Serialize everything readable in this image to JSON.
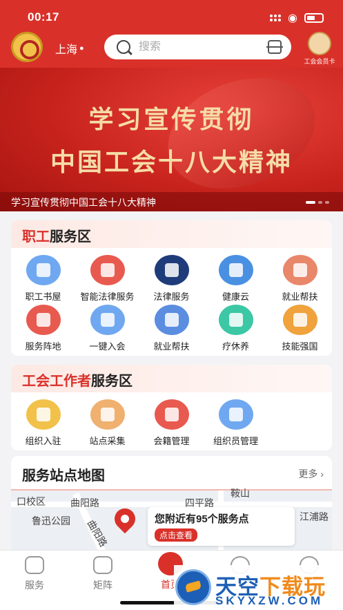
{
  "status_bar": {
    "time": "00:17"
  },
  "header": {
    "city": "上海",
    "search_placeholder": "搜索",
    "member_card_label": "工会会员卡"
  },
  "banner": {
    "line1": "学习宣传贯彻",
    "line2": "中国工会十八大精神",
    "caption": "学习宣传贯彻中国工会十八大精神",
    "slides": 3,
    "active_slide": 1
  },
  "employee_zone": {
    "title_red": "职工",
    "title_black": "服务区",
    "items": [
      {
        "label": "职工书屋",
        "icon": "book-icon",
        "color": "#6fa8f0"
      },
      {
        "label": "智能法律服务",
        "icon": "ai-law-icon",
        "color": "#e85a4f"
      },
      {
        "label": "法律服务",
        "icon": "12351-icon",
        "color": "#1f3c7a"
      },
      {
        "label": "健康云",
        "icon": "cloud-plus-icon",
        "color": "#4a90e2"
      },
      {
        "label": "就业帮扶",
        "icon": "resume-icon",
        "color": "#e9876a"
      },
      {
        "label": "服务阵地",
        "icon": "map-pin-icon",
        "color": "#e85a4f"
      },
      {
        "label": "一键入会",
        "icon": "user-join-icon",
        "color": "#6fa8f0"
      },
      {
        "label": "就业帮扶",
        "icon": "job-badge-icon",
        "color": "#5b8de0"
      },
      {
        "label": "疗休养",
        "icon": "palm-tree-icon",
        "color": "#3cc7a5"
      },
      {
        "label": "技能强国",
        "icon": "whistle-icon",
        "color": "#f0a23c"
      }
    ]
  },
  "worker_zone": {
    "title_red": "工会工作者",
    "title_black": "服务区",
    "items": [
      {
        "label": "组织入驻",
        "icon": "building-icon",
        "color": "#f2c14a"
      },
      {
        "label": "站点采集",
        "icon": "map-collect-icon",
        "color": "#f0b070"
      },
      {
        "label": "会籍管理",
        "icon": "member-manage-icon",
        "color": "#e85a4f"
      },
      {
        "label": "组织员管理",
        "icon": "staff-manage-icon",
        "color": "#6fa8f0"
      }
    ]
  },
  "map_section": {
    "title": "服务站点地图",
    "more_label": "更多",
    "popup_text": "您附近有95个服务点",
    "popup_button": "点击查看",
    "labels": {
      "district": "口校区",
      "road1": "曲阳路",
      "road2": "四平路",
      "park": "鲁迅公园",
      "road3": "曲阳路",
      "road4": "江浦路",
      "area": "鞍山"
    }
  },
  "tab_bar": {
    "tabs": [
      {
        "label": "服务",
        "icon": "service-hand-icon"
      },
      {
        "label": "矩阵",
        "icon": "institution-icon"
      },
      {
        "label": "首页",
        "icon": "home-icon"
      },
      {
        "label": "",
        "icon": "location-user-icon"
      },
      {
        "label": "",
        "icon": "profile-icon"
      }
    ],
    "active_index": 2
  },
  "watermark": {
    "big_blue": "天空",
    "big_orange": "下载玩",
    "small": "SKYXZW.COM"
  }
}
